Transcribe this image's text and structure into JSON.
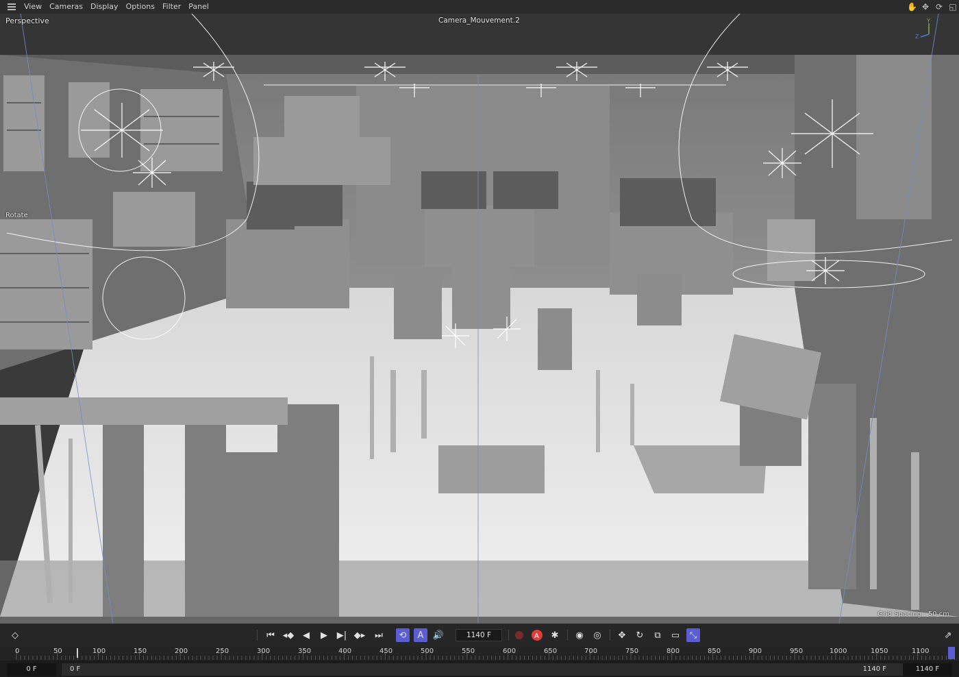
{
  "menu": {
    "items": [
      "View",
      "Cameras",
      "Display",
      "Options",
      "Filter",
      "Panel"
    ],
    "right_icons": [
      "pan-icon",
      "move-icon",
      "rotate-view-icon",
      "maximize-icon"
    ]
  },
  "viewport": {
    "projection_label": "Perspective",
    "camera_label": "Camera_Mouvement.2",
    "mode_label": "Rotate",
    "grid_spacing": "Grid Spacing : 50 cm",
    "axis_labels": {
      "y": "Y",
      "z": "Z"
    }
  },
  "transport": {
    "current_frame": "1140 F",
    "colors": {
      "active": "#5a5ed1",
      "record": "#e23b3b"
    }
  },
  "ruler": {
    "ticks": [
      "0",
      "50",
      "100",
      "150",
      "200",
      "250",
      "300",
      "350",
      "400",
      "450",
      "500",
      "550",
      "600",
      "650",
      "700",
      "750",
      "800",
      "850",
      "900",
      "950",
      "1000",
      "1050",
      "1100"
    ]
  },
  "range": {
    "start": "0 F",
    "preview_start": "0 F",
    "preview_end": "1140 F",
    "end": "1140 F"
  }
}
